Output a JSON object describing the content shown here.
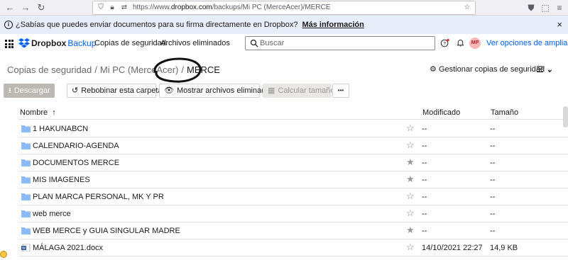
{
  "browser": {
    "url_prefix": "https://www.",
    "url_domain": "dropbox.com",
    "url_path": "/backups/Mi PC (MerceAcer)/MERCE"
  },
  "banner": {
    "text": "¿Sabías que puedes enviar documentos para su firma directamente en Dropbox?",
    "link": "Más información",
    "close": "×"
  },
  "header": {
    "brand": "Dropbox",
    "brand_sub": "Backup",
    "nav": [
      "Copias de seguridad",
      "Archivos eliminados"
    ],
    "search_placeholder": "Buscar",
    "avatar": "MP",
    "upgrade": "Ver opciones de ampliación"
  },
  "breadcrumb": {
    "items": [
      "Copias de seguridad",
      "Mi PC (MerceAcer)"
    ],
    "separator": "/",
    "current": "MERCE"
  },
  "manage": "Gestionar copias de seguridad",
  "toolbar": {
    "download": "Descargar",
    "rewind": "Rebobinar esta carpeta",
    "show_deleted": "Mostrar archivos eliminados",
    "calc_size": "Calcular tamaño",
    "more": "•••"
  },
  "table": {
    "col_name": "Nombre",
    "col_modified": "Modificado",
    "col_size": "Tamaño",
    "rows": [
      {
        "name": "1 HAKUNABCN",
        "type": "folder",
        "starred": false,
        "modified": "--",
        "size": "--"
      },
      {
        "name": "CALENDARIO-AGENDA",
        "type": "folder",
        "starred": false,
        "modified": "--",
        "size": "--"
      },
      {
        "name": "DOCUMENTOS MERCE",
        "type": "folder",
        "starred": true,
        "modified": "--",
        "size": "--"
      },
      {
        "name": "MIS IMAGENES",
        "type": "folder",
        "starred": true,
        "modified": "--",
        "size": "--"
      },
      {
        "name": "PLAN MARCA PERSONAL, MK Y PR",
        "type": "folder",
        "starred": false,
        "modified": "--",
        "size": "--"
      },
      {
        "name": "web merce",
        "type": "folder",
        "starred": false,
        "modified": "--",
        "size": "--"
      },
      {
        "name": "WEB MERCE y GUIA SINGULAR MADRE",
        "type": "folder",
        "starred": true,
        "modified": "--",
        "size": "--"
      },
      {
        "name": "MÁLAGA 2021.docx",
        "type": "docx",
        "starred": false,
        "modified": "14/10/2021 22:27",
        "size": "14,9 KB"
      }
    ]
  },
  "colors": {
    "accent": "#0061fe",
    "folder": "#8fbaf8",
    "banner_bg": "#e7eef9"
  }
}
